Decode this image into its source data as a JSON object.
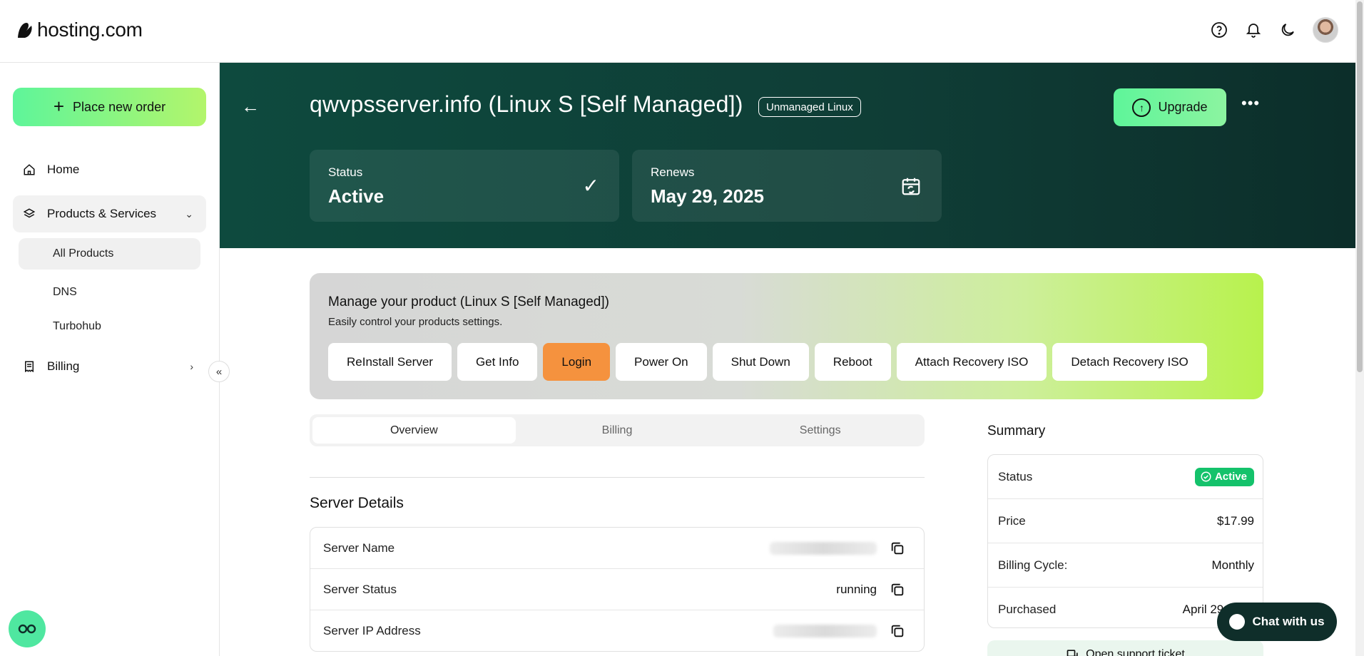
{
  "brand": {
    "name": "hosting.com"
  },
  "topbar": {
    "icons": [
      "help-circle-icon",
      "bell-icon",
      "moon-icon"
    ]
  },
  "sidebar": {
    "new_order_label": "Place new order",
    "home_label": "Home",
    "products_label": "Products & Services",
    "sub_items": [
      "All Products",
      "DNS",
      "Turbohub"
    ],
    "billing_label": "Billing"
  },
  "hero": {
    "title": "qwvpsserver.info (Linux S [Self Managed])",
    "badge": "Unmanaged Linux",
    "upgrade_label": "Upgrade",
    "status_card": {
      "label": "Status",
      "value": "Active"
    },
    "renews_card": {
      "label": "Renews",
      "value": "May 29, 2025"
    }
  },
  "manage": {
    "title": "Manage your product (Linux S [Self Managed])",
    "subtitle": "Easily control your products settings.",
    "actions": [
      "ReInstall Server",
      "Get Info",
      "Login",
      "Power On",
      "Shut Down",
      "Reboot",
      "Attach Recovery ISO",
      "Detach Recovery ISO"
    ]
  },
  "tabs": [
    "Overview",
    "Billing",
    "Settings"
  ],
  "server_details": {
    "title": "Server Details",
    "rows": [
      {
        "label": "Server Name",
        "value": ""
      },
      {
        "label": "Server Status",
        "value": "running"
      },
      {
        "label": "Server IP Address",
        "value": ""
      }
    ]
  },
  "summary": {
    "title": "Summary",
    "status_label": "Status",
    "status_value": "Active",
    "price_label": "Price",
    "price_value": "$17.99",
    "cycle_label": "Billing Cycle:",
    "cycle_value": "Monthly",
    "purchased_label": "Purchased",
    "purchased_value": "April 29,"
  },
  "support": {
    "ticket_label": "Open support ticket"
  },
  "chat": {
    "label": "Chat with us"
  },
  "colors": {
    "accent_green": "#5ef59a",
    "hero_bg": "#0e4a3e",
    "login_orange": "#f5923e",
    "status_green": "#14c26b"
  }
}
